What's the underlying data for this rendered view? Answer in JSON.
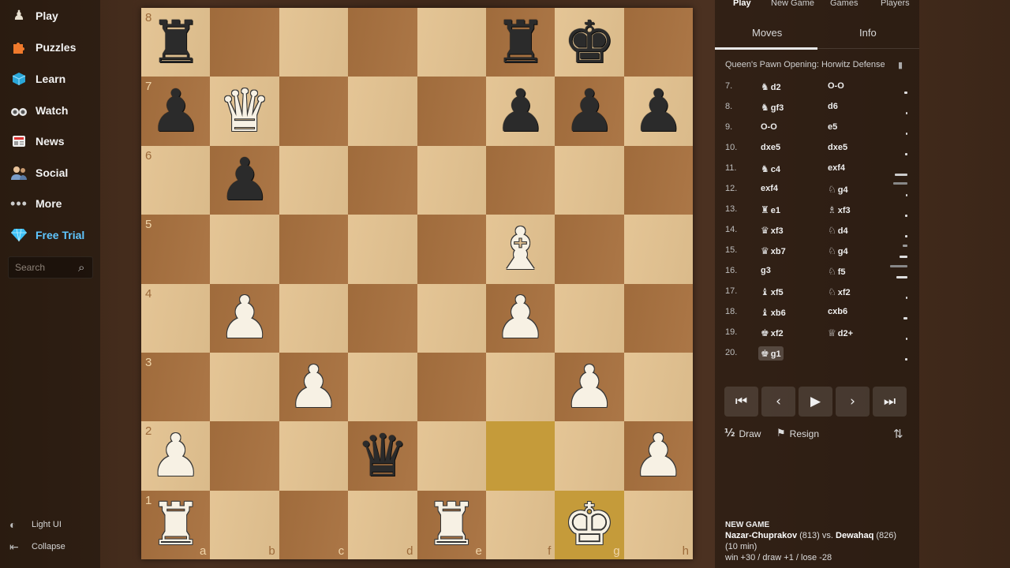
{
  "nav": {
    "items": [
      {
        "label": "Play",
        "icon": "pawn-icon"
      },
      {
        "label": "Puzzles",
        "icon": "puzzle-icon"
      },
      {
        "label": "Learn",
        "icon": "learn-icon"
      },
      {
        "label": "Watch",
        "icon": "binoculars-icon"
      },
      {
        "label": "News",
        "icon": "news-icon"
      },
      {
        "label": "Social",
        "icon": "social-icon"
      },
      {
        "label": "More",
        "icon": "more-icon"
      },
      {
        "label": "Free Trial",
        "icon": "diamond-icon"
      }
    ],
    "search_placeholder": "Search",
    "light_ui": "Light UI",
    "collapse": "Collapse"
  },
  "board": {
    "ranks": [
      "8",
      "7",
      "6",
      "5",
      "4",
      "3",
      "2",
      "1"
    ],
    "files": [
      "a",
      "b",
      "c",
      "d",
      "e",
      "f",
      "g",
      "h"
    ],
    "position": [
      [
        "bR",
        "",
        "",
        "",
        "",
        "bR",
        "bK",
        ""
      ],
      [
        "bP",
        "wQ",
        "",
        "",
        "",
        "bP",
        "bP",
        "bP"
      ],
      [
        "",
        "bP",
        "",
        "",
        "",
        "",
        "",
        ""
      ],
      [
        "",
        "",
        "",
        "",
        "",
        "wB",
        "",
        ""
      ],
      [
        "",
        "wP",
        "",
        "",
        "",
        "wP",
        "",
        ""
      ],
      [
        "",
        "",
        "wP",
        "",
        "",
        "",
        "wP",
        ""
      ],
      [
        "wP",
        "",
        "",
        "bQ",
        "",
        "",
        "",
        "wP"
      ],
      [
        "wR",
        "",
        "",
        "",
        "wR",
        "",
        "wK",
        ""
      ]
    ],
    "highlight": [
      "f2",
      "g1"
    ]
  },
  "panel": {
    "top_tabs": [
      "Play",
      "New Game",
      "Games",
      "Players"
    ],
    "sub_tabs": [
      "Moves",
      "Info"
    ],
    "opening": "Queen's Pawn Opening: Horwitz Defense",
    "moves": [
      {
        "n": "7.",
        "w": "d2",
        "wp": "♞",
        "b": "O-O",
        "bp": ""
      },
      {
        "n": "8.",
        "w": "gf3",
        "wp": "♞",
        "b": "d6",
        "bp": ""
      },
      {
        "n": "9.",
        "w": "O-O",
        "wp": "",
        "b": "e5",
        "bp": ""
      },
      {
        "n": "10.",
        "w": "dxe5",
        "wp": "",
        "b": "dxe5",
        "bp": ""
      },
      {
        "n": "11.",
        "w": "c4",
        "wp": "♞",
        "b": "exf4",
        "bp": ""
      },
      {
        "n": "12.",
        "w": "exf4",
        "wp": "",
        "b": "g4",
        "bp": "♘"
      },
      {
        "n": "13.",
        "w": "e1",
        "wp": "♜",
        "b": "xf3",
        "bp": "♗"
      },
      {
        "n": "14.",
        "w": "xf3",
        "wp": "♛",
        "b": "d4",
        "bp": "♘"
      },
      {
        "n": "15.",
        "w": "xb7",
        "wp": "♛",
        "b": "g4",
        "bp": "♘"
      },
      {
        "n": "16.",
        "w": "g3",
        "wp": "",
        "b": "f5",
        "bp": "♘"
      },
      {
        "n": "17.",
        "w": "xf5",
        "wp": "♝",
        "b": "xf2",
        "bp": "♘"
      },
      {
        "n": "18.",
        "w": "xb6",
        "wp": "♝",
        "b": "cxb6",
        "bp": ""
      },
      {
        "n": "19.",
        "w": "xf2",
        "wp": "♚",
        "b": "d2+",
        "bp": "♕"
      },
      {
        "n": "20.",
        "w": "g1",
        "wp": "♚",
        "b": "",
        "bp": ""
      }
    ],
    "controls": [
      "⏮",
      "‹",
      "▶",
      "›",
      "⏭"
    ],
    "draw_icon": "½",
    "draw": "Draw",
    "resign_icon": "⚑",
    "resign": "Resign",
    "flip_icon": "⇅",
    "game": {
      "title": "NEW GAME",
      "white": "Nazar-Chuprakov",
      "white_rating": "(813)",
      "vs": "vs.",
      "black": "Dewahaq",
      "black_rating": "(826)",
      "time": "(10 min)",
      "stakes": "win +30 / draw +1 / lose -28"
    }
  }
}
